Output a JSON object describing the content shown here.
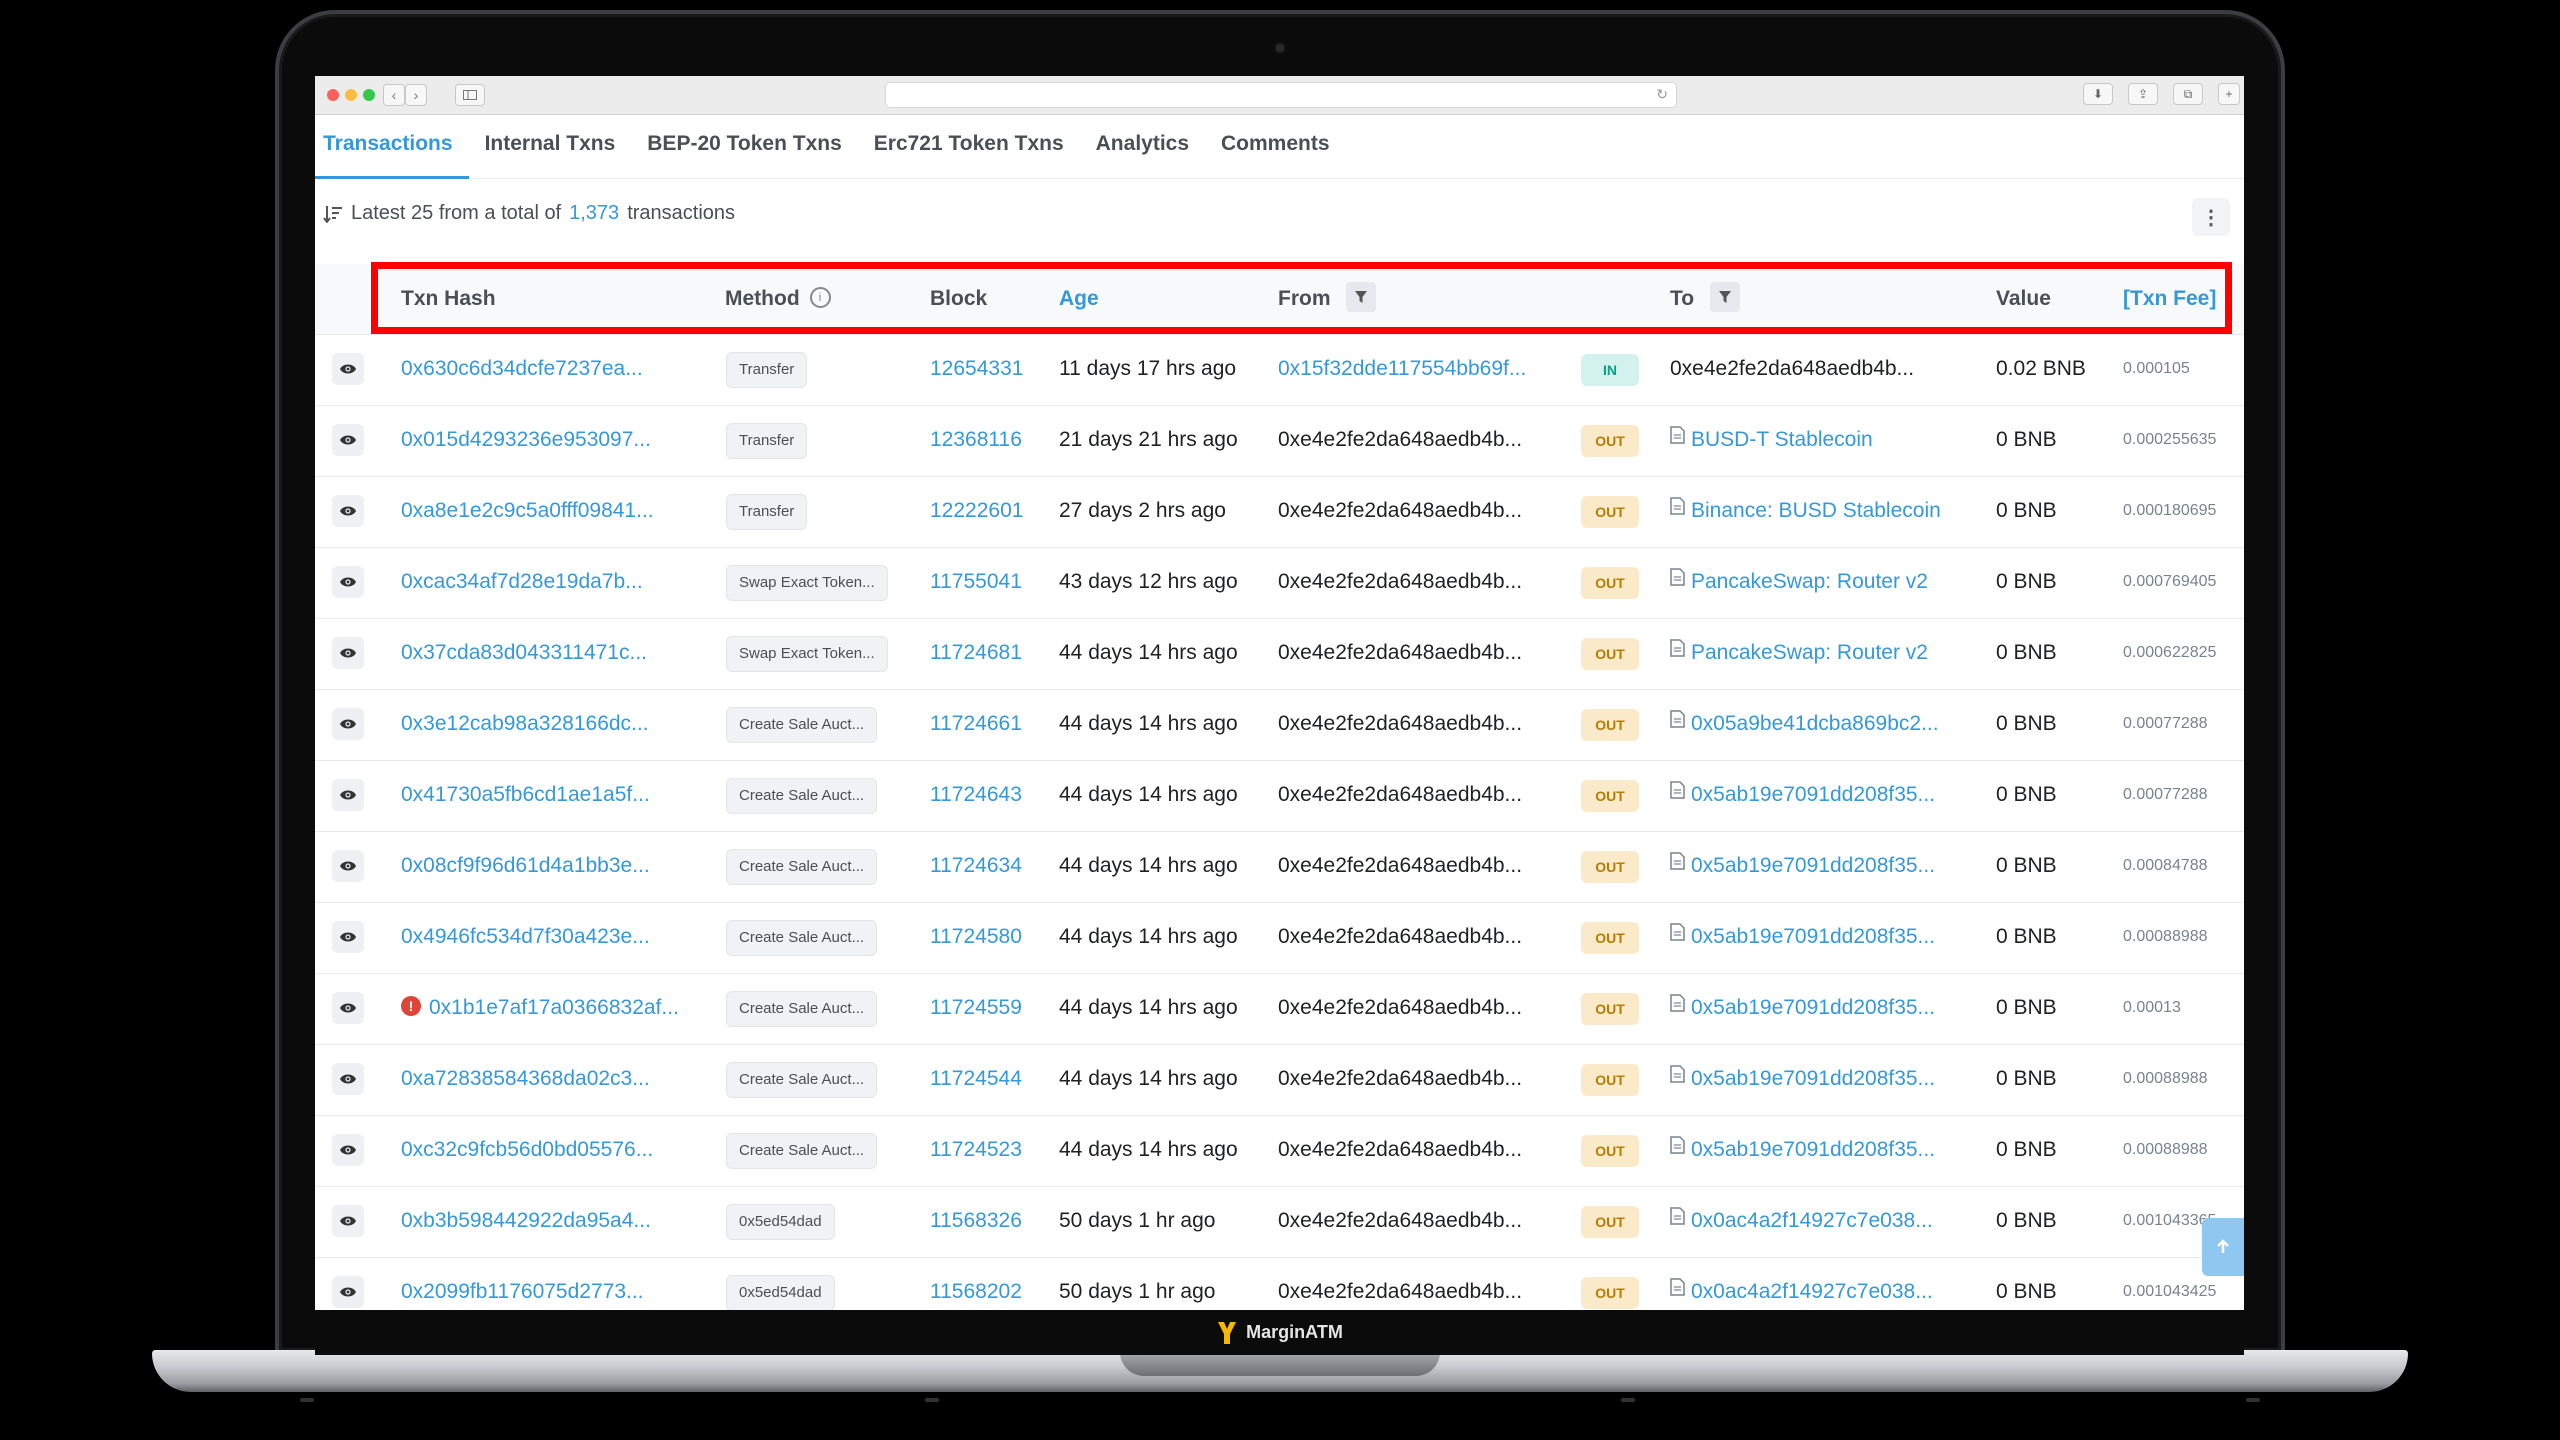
{
  "tabs": [
    "Transactions",
    "Internal Txns",
    "BEP-20 Token Txns",
    "Erc721 Token Txns",
    "Analytics",
    "Comments"
  ],
  "summary": {
    "prefix": "Latest 25 from a total of",
    "count": "1,373",
    "suffix": "transactions"
  },
  "columns": {
    "txn_hash": "Txn Hash",
    "method": "Method",
    "block": "Block",
    "age": "Age",
    "from": "From",
    "to": "To",
    "value": "Value",
    "txn_fee": "[Txn Fee]"
  },
  "rows": [
    {
      "hash": "0x630c6d34dcfe7237ea...",
      "method": "Transfer",
      "block": "12654331",
      "age": "11 days 17 hrs ago",
      "from": "0x15f32dde117554bb69f...",
      "dir": "IN",
      "to": "0xe4e2fe2da648aedb4b...",
      "to_contract": false,
      "value": "0.02 BNB",
      "fee": "0.000105",
      "error": false
    },
    {
      "hash": "0x015d4293236e953097...",
      "method": "Transfer",
      "block": "12368116",
      "age": "21 days 21 hrs ago",
      "from": "0xe4e2fe2da648aedb4b...",
      "dir": "OUT",
      "to": "BUSD-T Stablecoin",
      "to_contract": true,
      "value": "0 BNB",
      "fee": "0.000255635",
      "error": false
    },
    {
      "hash": "0xa8e1e2c9c5a0fff09841...",
      "method": "Transfer",
      "block": "12222601",
      "age": "27 days 2 hrs ago",
      "from": "0xe4e2fe2da648aedb4b...",
      "dir": "OUT",
      "to": "Binance: BUSD Stablecoin",
      "to_contract": true,
      "value": "0 BNB",
      "fee": "0.000180695",
      "error": false
    },
    {
      "hash": "0xcac34af7d28e19da7b...",
      "method": "Swap Exact Token...",
      "block": "11755041",
      "age": "43 days 12 hrs ago",
      "from": "0xe4e2fe2da648aedb4b...",
      "dir": "OUT",
      "to": "PancakeSwap: Router v2",
      "to_contract": true,
      "value": "0 BNB",
      "fee": "0.000769405",
      "error": false
    },
    {
      "hash": "0x37cda83d043311471c...",
      "method": "Swap Exact Token...",
      "block": "11724681",
      "age": "44 days 14 hrs ago",
      "from": "0xe4e2fe2da648aedb4b...",
      "dir": "OUT",
      "to": "PancakeSwap: Router v2",
      "to_contract": true,
      "value": "0 BNB",
      "fee": "0.000622825",
      "error": false
    },
    {
      "hash": "0x3e12cab98a328166dc...",
      "method": "Create Sale Auct...",
      "block": "11724661",
      "age": "44 days 14 hrs ago",
      "from": "0xe4e2fe2da648aedb4b...",
      "dir": "OUT",
      "to": "0x05a9be41dcba869bc2...",
      "to_contract": true,
      "value": "0 BNB",
      "fee": "0.00077288",
      "error": false
    },
    {
      "hash": "0x41730a5fb6cd1ae1a5f...",
      "method": "Create Sale Auct...",
      "block": "11724643",
      "age": "44 days 14 hrs ago",
      "from": "0xe4e2fe2da648aedb4b...",
      "dir": "OUT",
      "to": "0x5ab19e7091dd208f35...",
      "to_contract": true,
      "value": "0 BNB",
      "fee": "0.00077288",
      "error": false
    },
    {
      "hash": "0x08cf9f96d61d4a1bb3e...",
      "method": "Create Sale Auct...",
      "block": "11724634",
      "age": "44 days 14 hrs ago",
      "from": "0xe4e2fe2da648aedb4b...",
      "dir": "OUT",
      "to": "0x5ab19e7091dd208f35...",
      "to_contract": true,
      "value": "0 BNB",
      "fee": "0.00084788",
      "error": false
    },
    {
      "hash": "0x4946fc534d7f30a423e...",
      "method": "Create Sale Auct...",
      "block": "11724580",
      "age": "44 days 14 hrs ago",
      "from": "0xe4e2fe2da648aedb4b...",
      "dir": "OUT",
      "to": "0x5ab19e7091dd208f35...",
      "to_contract": true,
      "value": "0 BNB",
      "fee": "0.00088988",
      "error": false
    },
    {
      "hash": "0x1b1e7af17a0366832af...",
      "method": "Create Sale Auct...",
      "block": "11724559",
      "age": "44 days 14 hrs ago",
      "from": "0xe4e2fe2da648aedb4b...",
      "dir": "OUT",
      "to": "0x5ab19e7091dd208f35...",
      "to_contract": true,
      "value": "0 BNB",
      "fee": "0.00013",
      "error": true
    },
    {
      "hash": "0xa72838584368da02c3...",
      "method": "Create Sale Auct...",
      "block": "11724544",
      "age": "44 days 14 hrs ago",
      "from": "0xe4e2fe2da648aedb4b...",
      "dir": "OUT",
      "to": "0x5ab19e7091dd208f35...",
      "to_contract": true,
      "value": "0 BNB",
      "fee": "0.00088988",
      "error": false
    },
    {
      "hash": "0xc32c9fcb56d0bd05576...",
      "method": "Create Sale Auct...",
      "block": "11724523",
      "age": "44 days 14 hrs ago",
      "from": "0xe4e2fe2da648aedb4b...",
      "dir": "OUT",
      "to": "0x5ab19e7091dd208f35...",
      "to_contract": true,
      "value": "0 BNB",
      "fee": "0.00088988",
      "error": false
    },
    {
      "hash": "0xb3b598442922da95a4...",
      "method": "0x5ed54dad",
      "block": "11568326",
      "age": "50 days 1 hr ago",
      "from": "0xe4e2fe2da648aedb4b...",
      "dir": "OUT",
      "to": "0x0ac4a2f14927c7e038...",
      "to_contract": true,
      "value": "0 BNB",
      "fee": "0.001043365",
      "error": false
    },
    {
      "hash": "0x2099fb1176075d2773...",
      "method": "0x5ed54dad",
      "block": "11568202",
      "age": "50 days 1 hr ago",
      "from": "0xe4e2fe2da648aedb4b...",
      "dir": "OUT",
      "to": "0x0ac4a2f14927c7e038...",
      "to_contract": true,
      "value": "0 BNB",
      "fee": "0.001043425",
      "error": false
    }
  ],
  "brand": "MarginATM",
  "colors": {
    "link": "#3498db",
    "highlight_box": "#ff0000",
    "badge_out_bg": "#fbeac9",
    "badge_in_bg": "#d3f2ee",
    "error": "#de4437"
  },
  "icons": [
    "eye-icon",
    "filter-icon",
    "info-icon",
    "document-icon",
    "error-icon",
    "sort-icon",
    "kebab-icon",
    "arrow-up-icon"
  ]
}
